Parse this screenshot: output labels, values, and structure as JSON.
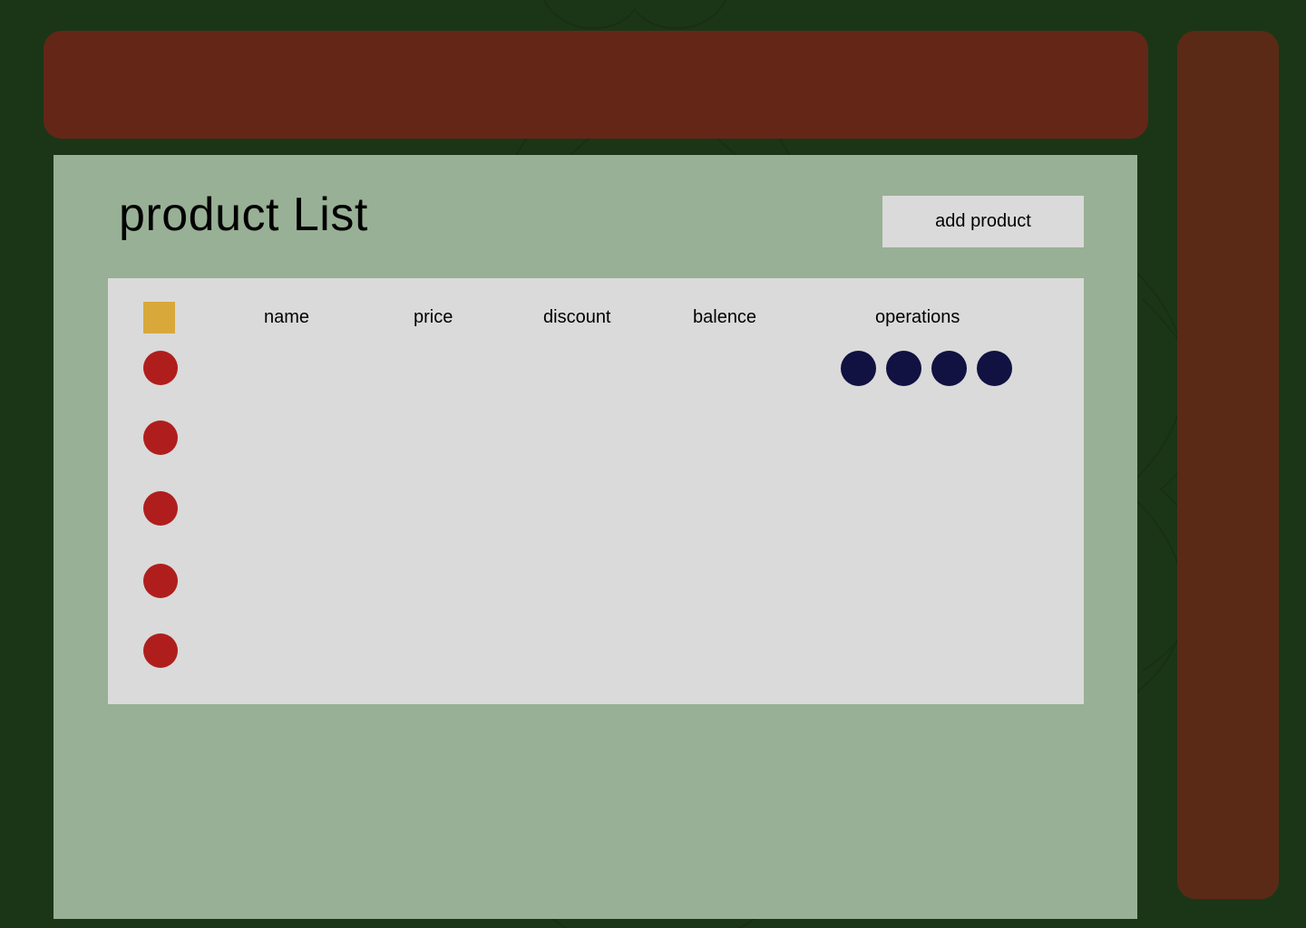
{
  "page": {
    "title": "product List",
    "add_button_label": "add product"
  },
  "table": {
    "columns": [
      "name",
      "price",
      "discount",
      "balence",
      "operations"
    ],
    "rows": [
      {
        "selected": false
      },
      {
        "selected": false
      },
      {
        "selected": false
      },
      {
        "selected": false
      },
      {
        "selected": false
      }
    ],
    "operations_count": 4
  },
  "colors": {
    "background": "#1b3616",
    "banner": "#672718",
    "side_panel": "#5e2a17",
    "main_panel": "#98b095",
    "table_card": "#dadada",
    "select_all": "#d8a93a",
    "row_marker": "#af1e1d",
    "operation_button": "#111142"
  }
}
